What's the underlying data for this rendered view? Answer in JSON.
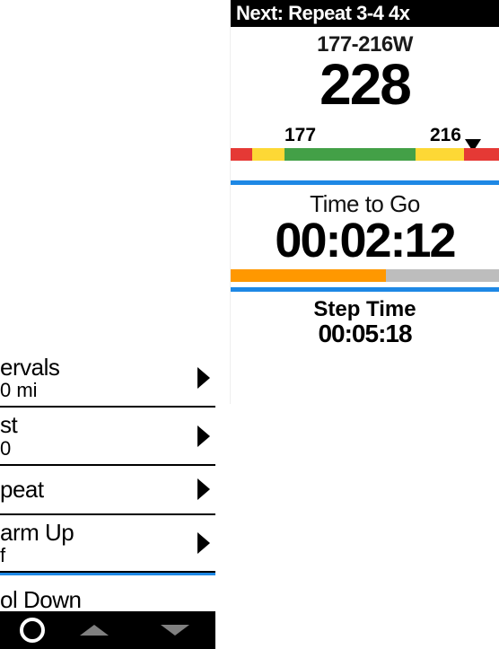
{
  "left": {
    "items": [
      {
        "title": "ervals",
        "sub": "0 mi"
      },
      {
        "title": "st",
        "sub": "0"
      },
      {
        "title": "peat",
        "sub": ""
      },
      {
        "title": "arm Up",
        "sub": "f"
      },
      {
        "title": "ol Down",
        "sub": ""
      }
    ],
    "icons": {
      "back": "back-circle-icon",
      "up": "nav-up-icon",
      "down": "nav-down-icon"
    }
  },
  "right": {
    "header": "Next: Repeat 3-4 4x",
    "power": {
      "target_label": "177-216W",
      "current": "228",
      "scale_low": "177",
      "scale_high": "216"
    },
    "time_to_go": {
      "label": "Time to Go",
      "value": "00:02:12",
      "progress_pct": 58
    },
    "step_time": {
      "label": "Step Time",
      "value": "00:05:18"
    },
    "colors": {
      "accent_blue": "#1e88e5",
      "progress_fill": "#ff9800",
      "zone_red": "#e53935",
      "zone_yellow": "#fdd835",
      "zone_green": "#43a047"
    }
  }
}
